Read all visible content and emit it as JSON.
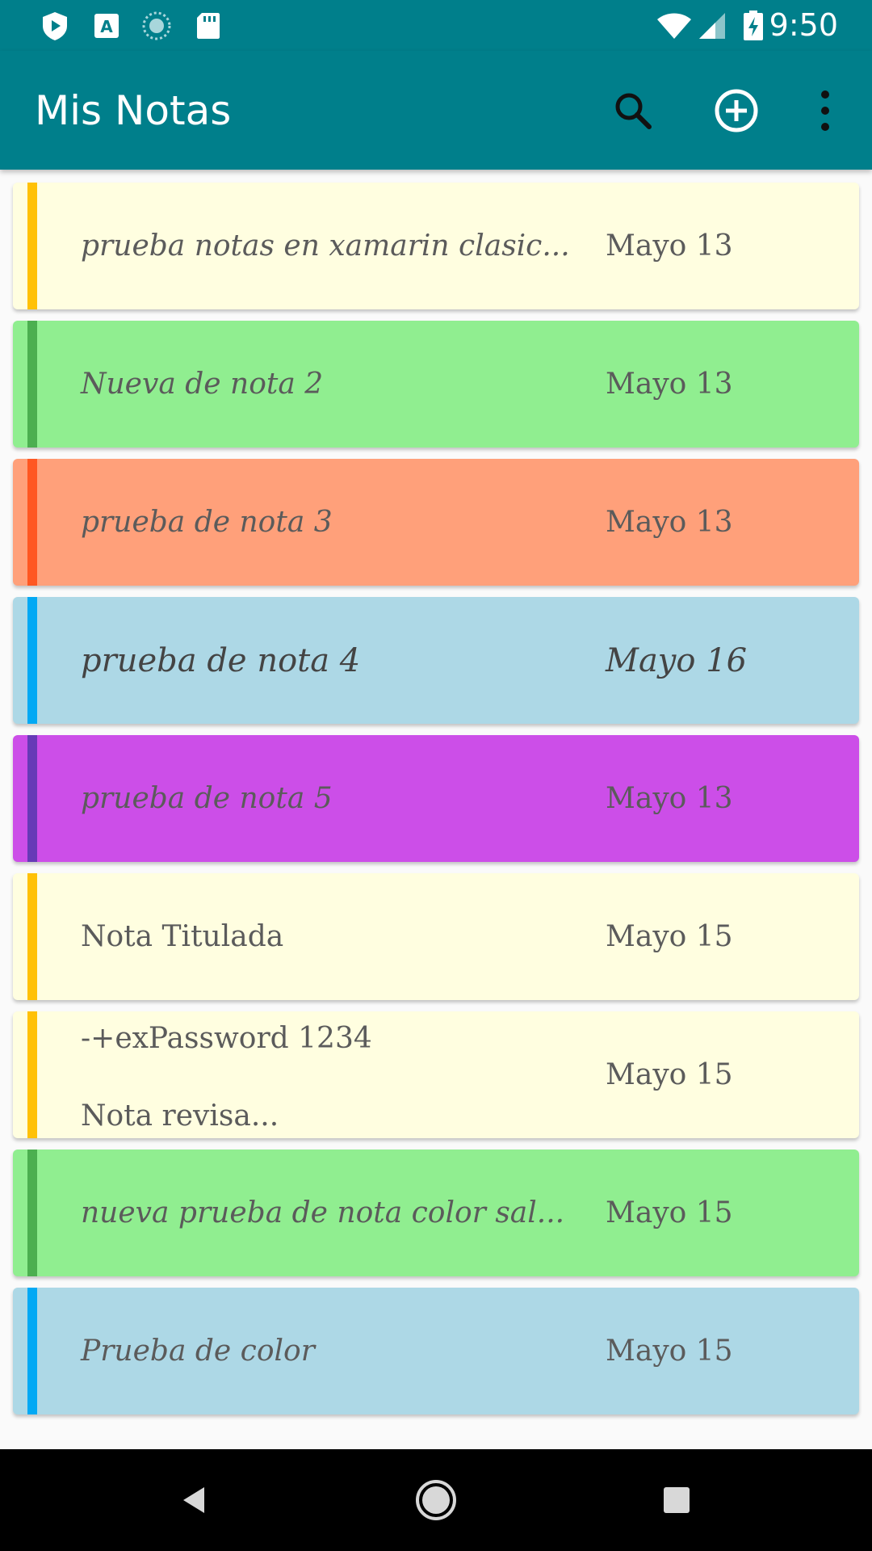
{
  "status_bar": {
    "time": "9:50",
    "left_icons": [
      "play-protect-icon",
      "accessibility-a-icon",
      "sync-circle-icon",
      "sd-card-icon"
    ],
    "right_icons": [
      "wifi-icon",
      "signal-icon",
      "battery-charging-icon"
    ]
  },
  "app_bar": {
    "title": "Mis Notas",
    "actions": [
      "search-icon",
      "add-circle-icon",
      "more-vert-icon"
    ]
  },
  "notes": [
    {
      "title": "prueba notas en xamarin clasic...",
      "date": "Mayo 13",
      "bg": "#fffee0",
      "bar": "#ffc107",
      "style": "italic"
    },
    {
      "title": "Nueva de nota 2",
      "date": "Mayo 13",
      "bg": "#90ee90",
      "bar": "#4caf50",
      "style": "italic"
    },
    {
      "title": "prueba de nota 3",
      "date": "Mayo 13",
      "bg": "#ffa07a",
      "bar": "#ff5722",
      "style": "italic"
    },
    {
      "title": "prueba de nota 4",
      "date": "Mayo 16",
      "bg": "#add8e6",
      "bar": "#03a9f4",
      "style": "script"
    },
    {
      "title": "prueba de nota 5",
      "date": "Mayo 13",
      "bg": "#cc4ee8",
      "bar": "#673ab7",
      "style": "italic"
    },
    {
      "title": "Nota Titulada",
      "date": "Mayo 15",
      "bg": "#fffee0",
      "bar": "#ffc107",
      "style": "normal"
    },
    {
      "title": "-+exPassword 1234\n\nNota revisa...",
      "date": "Mayo 15",
      "bg": "#fffee0",
      "bar": "#ffc107",
      "style": "multi"
    },
    {
      "title": "nueva prueba de nota color sal...",
      "date": "Mayo 15",
      "bg": "#90ee90",
      "bar": "#4caf50",
      "style": "italic"
    },
    {
      "title": "Prueba de color",
      "date": "Mayo 15",
      "bg": "#add8e6",
      "bar": "#03a9f4",
      "style": "italic"
    }
  ],
  "nav_bar": {
    "buttons": [
      "back-icon",
      "home-icon",
      "recents-icon"
    ]
  }
}
